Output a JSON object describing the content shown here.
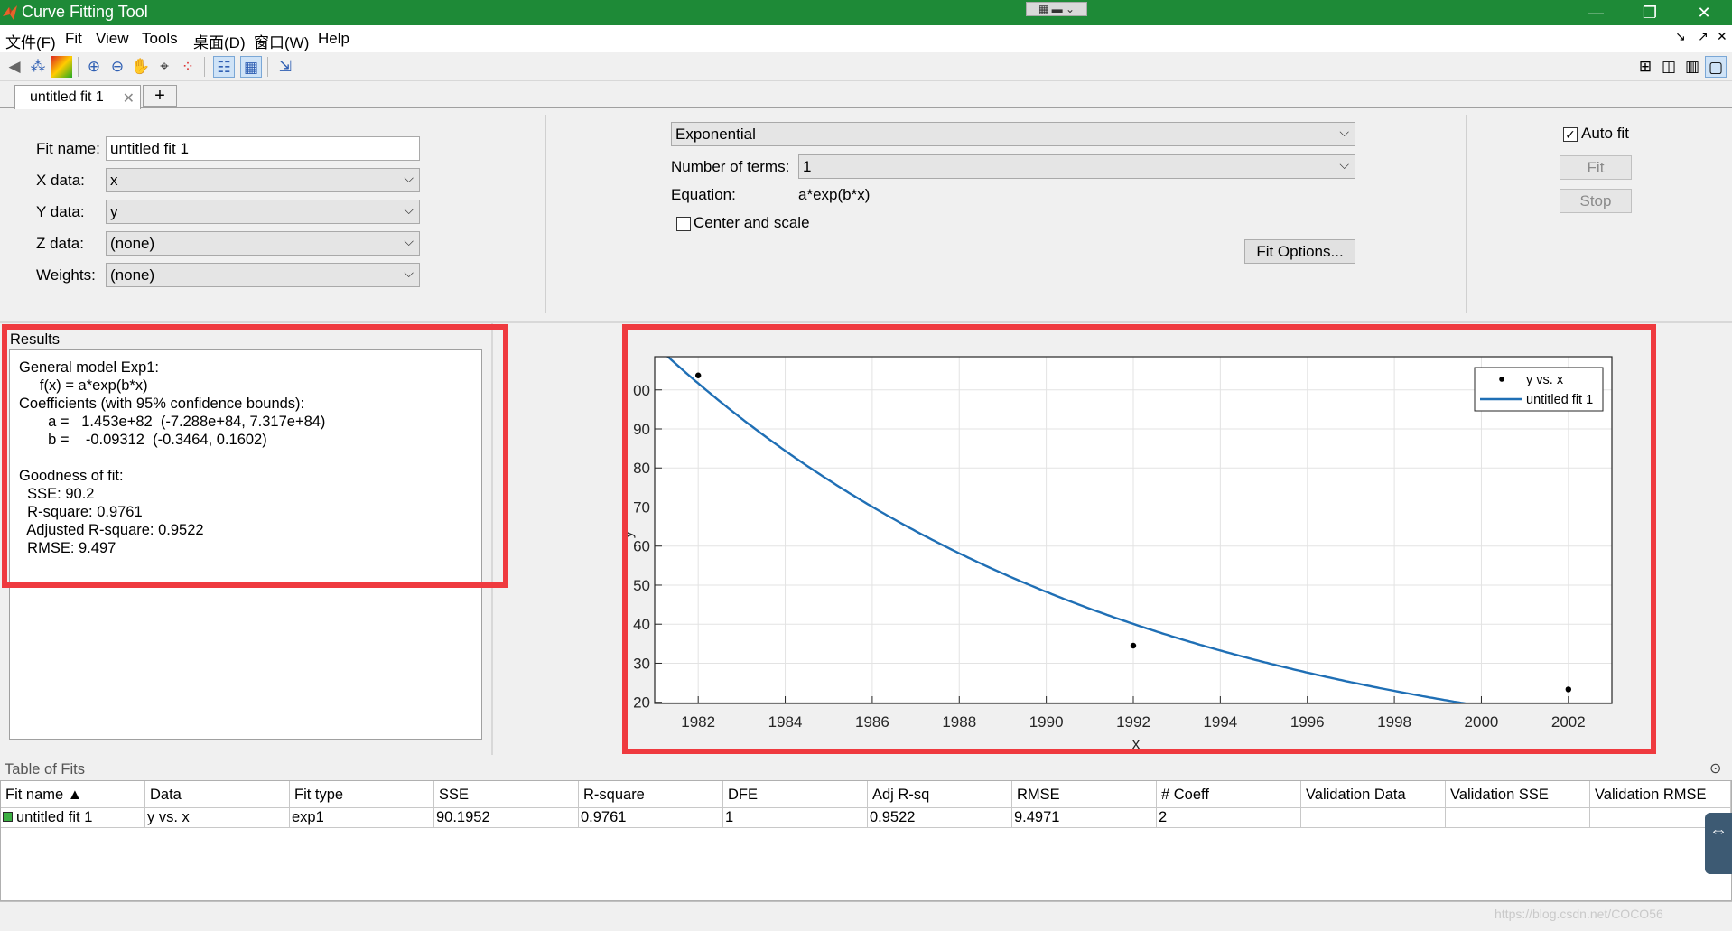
{
  "window": {
    "title": "Curve Fitting Tool",
    "minimize": "—",
    "restore": "❐",
    "close": "✕"
  },
  "menubar": {
    "items": [
      {
        "label": "文件(F)"
      },
      {
        "label": "Fit"
      },
      {
        "label": "View"
      },
      {
        "label": "Tools"
      },
      {
        "label": "桌面(D)"
      },
      {
        "label": "窗口(W)"
      },
      {
        "label": "Help"
      }
    ],
    "right": [
      "↘",
      "↗",
      "✕"
    ]
  },
  "tabs": {
    "active": "untitled fit 1",
    "close": "✕",
    "add": "+"
  },
  "fit": {
    "name_label": "Fit name:",
    "name_value": "untitled fit 1",
    "x_label": "X data:",
    "x_value": "x",
    "y_label": "Y data:",
    "y_value": "y",
    "z_label": "Z data:",
    "z_value": "(none)",
    "w_label": "Weights:",
    "w_value": "(none)",
    "type": "Exponential",
    "terms_label": "Number of terms:",
    "terms_value": "1",
    "equation_label": "Equation:",
    "equation_value": "a*exp(b*x)",
    "center_scale": "Center and scale",
    "center_scale_checked": false,
    "options_button": "Fit Options...",
    "auto_fit": "Auto fit",
    "auto_fit_checked": true,
    "fit_button": "Fit",
    "stop_button": "Stop"
  },
  "results": {
    "title": "Results",
    "lines": [
      "General model Exp1:",
      "     f(x) = a*exp(b*x)",
      "Coefficients (with 95% confidence bounds):",
      "       a =   1.453e+82  (-7.288e+84, 7.317e+84)",
      "       b =    -0.09312  (-0.3464, 0.1602)",
      "",
      "Goodness of fit:",
      "  SSE: 90.2",
      "  R-square: 0.9761",
      "  Adjusted R-square: 0.9522",
      "  RMSE: 9.497"
    ]
  },
  "chart_data": {
    "type": "scatter",
    "xlabel": "x",
    "ylabel": "y",
    "xlim": [
      1981,
      2003
    ],
    "ylim": [
      19.7,
      108.5
    ],
    "xticks": [
      1982,
      1984,
      1986,
      1988,
      1990,
      1992,
      1994,
      1996,
      1998,
      2000,
      2002
    ],
    "yticks": [
      20,
      30,
      40,
      50,
      60,
      70,
      80,
      90,
      100
    ],
    "ytick_labels": [
      "20",
      "30",
      "40",
      "50",
      "60",
      "70",
      "80",
      "90",
      "00"
    ],
    "grid": true,
    "legend_position": "top-right",
    "series": [
      {
        "name": "y vs. x",
        "kind": "points",
        "x": [
          1982,
          1992,
          2002
        ],
        "y": [
          103.7,
          34.5,
          23.3
        ],
        "color": "#000000"
      },
      {
        "name": "untitled fit 1",
        "kind": "line",
        "a": 1.453e+82,
        "b": -0.09312,
        "color": "#1f6fb5"
      }
    ]
  },
  "table": {
    "title": "Table of Fits",
    "columns": [
      "Fit name ▲",
      "Data",
      "Fit type",
      "SSE",
      "R-square",
      "DFE",
      "Adj R-sq",
      "RMSE",
      "# Coeff",
      "Validation Data",
      "Validation SSE",
      "Validation RMSE"
    ],
    "rows": [
      [
        "untitled fit 1",
        "y vs. x",
        "exp1",
        "90.1952",
        "0.9761",
        "1",
        "0.9522",
        "9.4971",
        "2",
        "",
        "",
        ""
      ]
    ],
    "row_color": "#3cb043"
  },
  "watermark": "https://blog.csdn.net/COCO56"
}
